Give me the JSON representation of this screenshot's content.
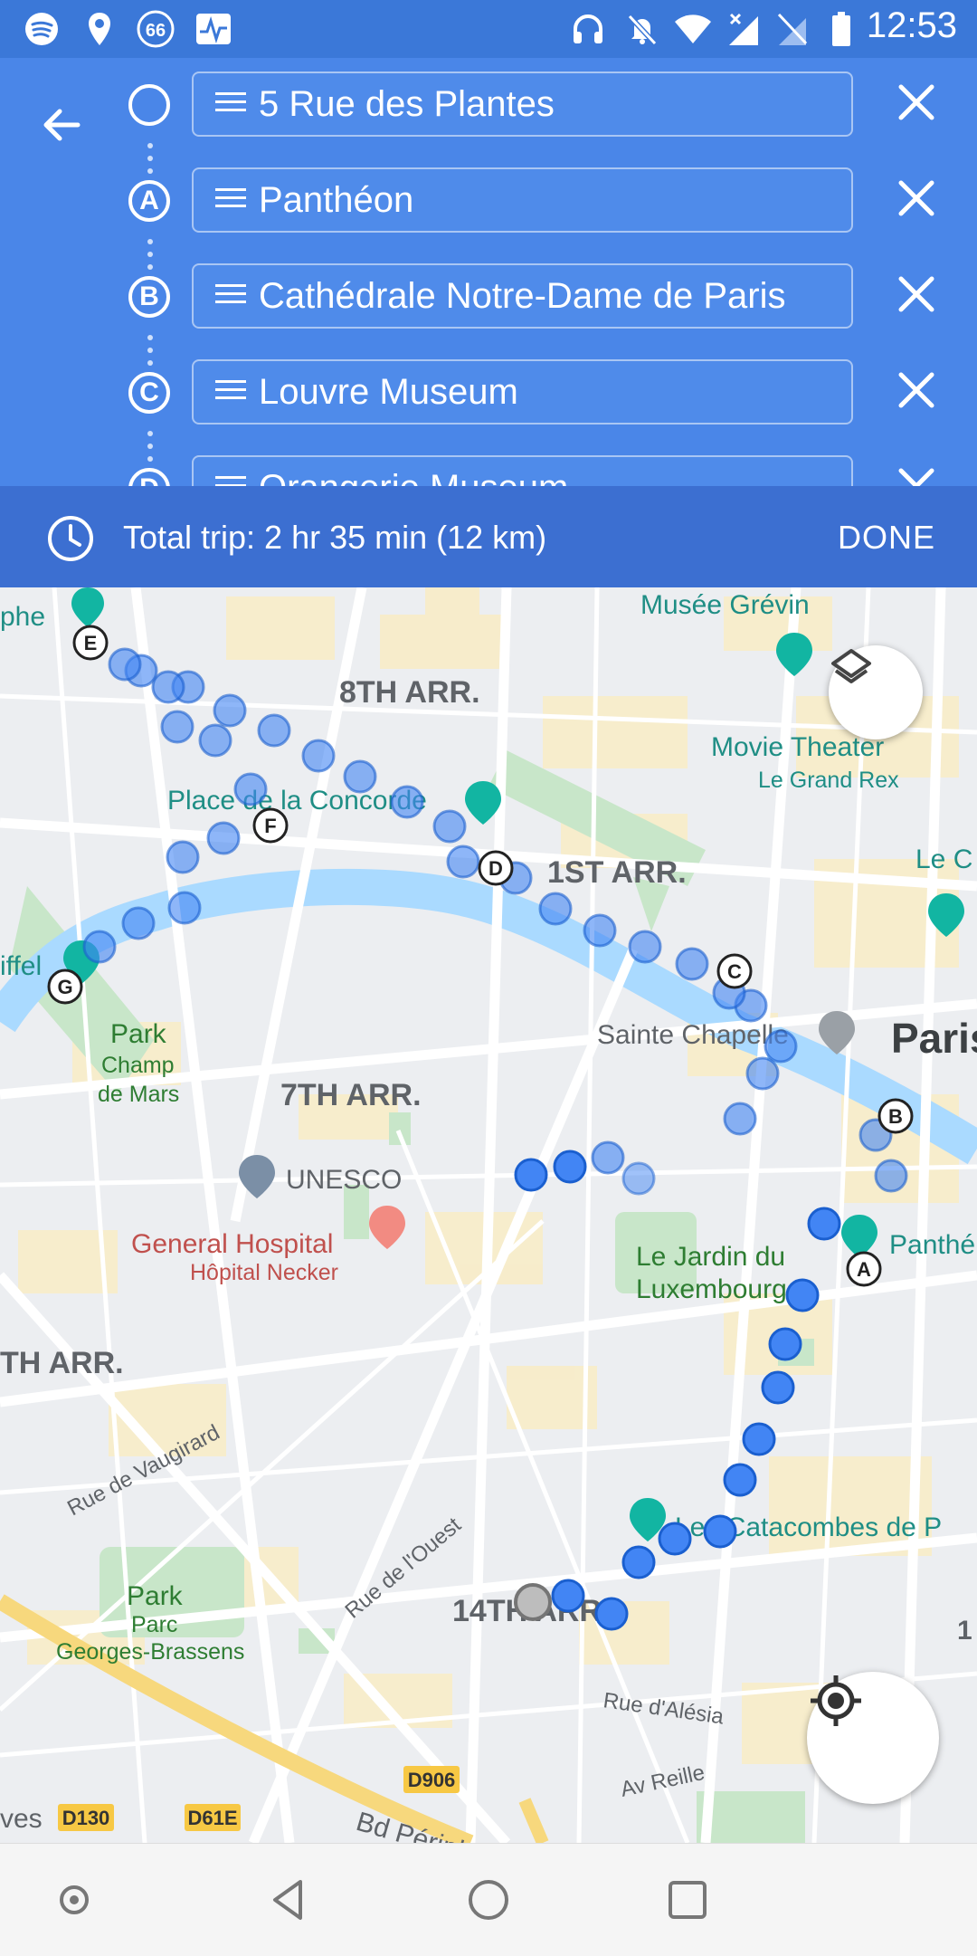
{
  "status_bar": {
    "time": "12:53",
    "left_icons": [
      "spotify-icon",
      "location-icon",
      "badge-66-icon",
      "activity-icon"
    ],
    "right_icons": [
      "headphones-icon",
      "do-not-disturb-icon",
      "wifi-icon",
      "signal-icon",
      "no-sim-icon",
      "battery-icon"
    ],
    "badge_text": "66"
  },
  "directions": {
    "back_icon": "arrow-back-icon",
    "stops": [
      {
        "marker": "",
        "label": "5 Rue des Plantes"
      },
      {
        "marker": "A",
        "label": "Panthéon"
      },
      {
        "marker": "B",
        "label": "Cathédrale Notre-Dame de Paris"
      },
      {
        "marker": "C",
        "label": "Louvre Museum"
      },
      {
        "marker": "D",
        "label": "Orangerie Museum"
      }
    ]
  },
  "trip": {
    "summary": "Total trip: 2 hr 35 min   (12 km)",
    "done_label": "DONE"
  },
  "map": {
    "district_labels": [
      "8TH ARR.",
      "1ST ARR.",
      "7TH ARR.",
      "TH ARR.",
      "14TH ARR."
    ],
    "place_labels": [
      "Musée Grévin",
      "Movie Theater",
      "Le Grand Rex",
      "Place de la Concorde",
      "Sainte Chapelle",
      "Paris",
      "Park",
      "Champ",
      "de Mars",
      "UNESCO",
      "General Hospital",
      "Hôpital Necker",
      "Le Jardin du",
      "Luxembourg",
      "Panthé",
      "Les Catacombes de P",
      "Park",
      "Parc",
      "Georges-Brassens",
      "phe",
      "iffel",
      "Le C"
    ],
    "street_labels": [
      "Rue de Vaugirard",
      "Rue de l'Ouest",
      "Rue d'Alésia",
      "Av Reille",
      "Bd Périph"
    ],
    "road_badges": [
      "D906",
      "D130",
      "D61E"
    ],
    "edge_text": [
      "ves",
      "1"
    ],
    "waypoint_markers": [
      "A",
      "B",
      "C",
      "D",
      "E",
      "F",
      "G"
    ],
    "colors": {
      "route": "#4285f4",
      "water": "#aadaff",
      "park": "#c8e6c9",
      "urban": "#f8ecc9"
    }
  },
  "controls": {
    "layers_icon": "layers-icon",
    "locate_icon": "my-location-icon"
  },
  "nav_bar": [
    "assistant-dot-icon",
    "back-triangle-icon",
    "home-circle-icon",
    "recents-square-icon"
  ]
}
